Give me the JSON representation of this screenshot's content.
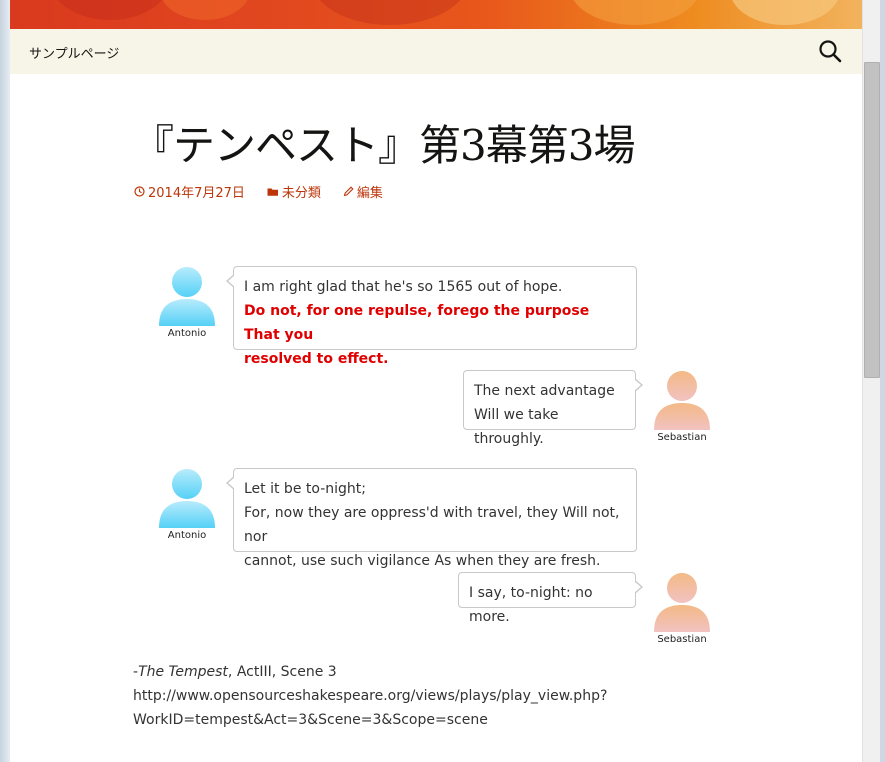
{
  "nav": {
    "page_link": "サンプルページ"
  },
  "post": {
    "title": "『テンペスト』第3幕第3場",
    "meta": {
      "date": "2014年7月27日",
      "category": "未分類",
      "edit": "編集"
    }
  },
  "conversation": [
    {
      "speaker": "Antonio",
      "side": "left",
      "lines": [
        "I am right glad that he's so 1565 out of hope."
      ],
      "emphasis": [
        "Do not, for one repulse, forego the purpose That you",
        "resolved to effect."
      ]
    },
    {
      "speaker": "Sebastian",
      "side": "right",
      "lines": [
        "The next advantage",
        "Will we take throughly."
      ]
    },
    {
      "speaker": "Antonio",
      "side": "left",
      "lines": [
        "Let it be to-night;",
        "For, now they are oppress'd with travel, they Will not, nor",
        "cannot, use such vigilance As when they are fresh."
      ]
    },
    {
      "speaker": "Sebastian",
      "side": "right",
      "lines": [
        "I say, to-night: no more."
      ]
    }
  ],
  "source": {
    "prefix": "-",
    "work": "The Tempest",
    "citation": ", ActIII, Scene 3",
    "url_line1": "http://www.opensourceshakespeare.org/views/plays/play_view.php?",
    "url_line2": "WorkID=tempest&Act=3&Scene=3&Scope=scene"
  },
  "colors": {
    "nav_background": "#f7f5e7",
    "meta_link": "#bc360a",
    "emphasis_red": "#e00000",
    "antonio_avatar": "#6ed8f8",
    "sebastian_avatar": "#f2bb90"
  },
  "icons": {
    "search": "search-icon",
    "date": "clock-icon",
    "category": "folder-icon",
    "edit": "pencil-icon",
    "antonio": "person-avatar-blue",
    "sebastian": "person-avatar-peach"
  }
}
